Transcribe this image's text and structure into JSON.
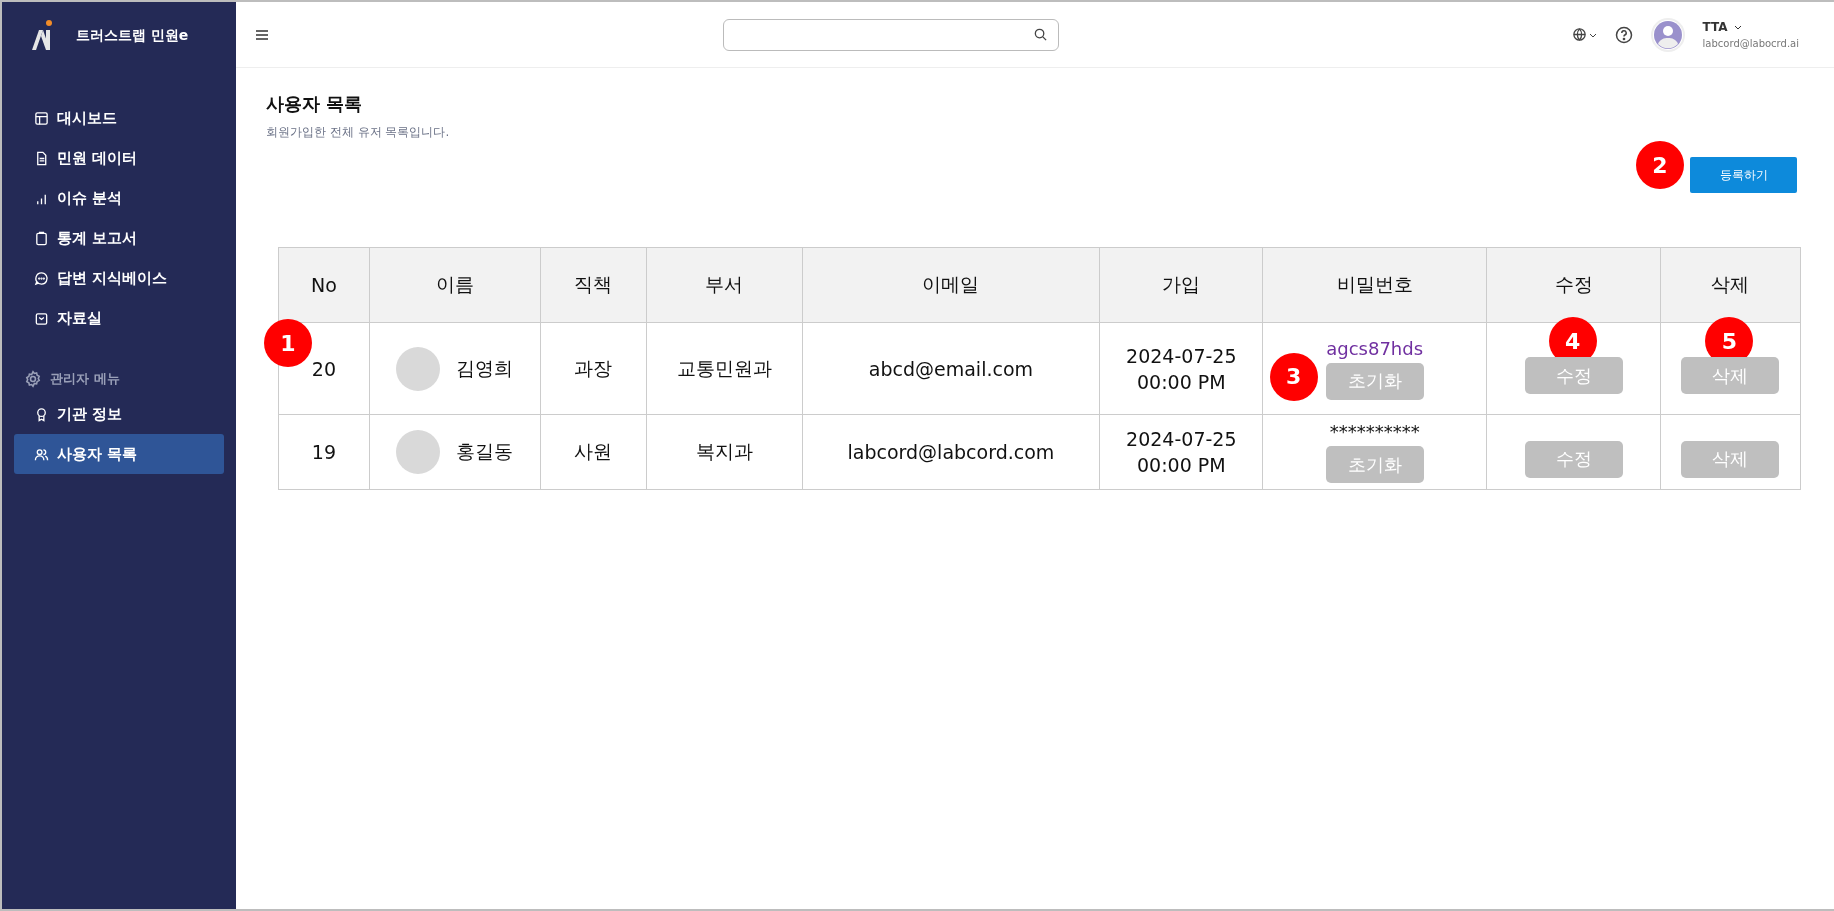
{
  "sidebar": {
    "brand": "트러스트랩 민원e",
    "items": [
      {
        "label": "대시보드",
        "selected": false
      },
      {
        "label": "민원 데이터",
        "selected": false
      },
      {
        "label": "이슈 분석",
        "selected": false
      },
      {
        "label": "통계 보고서",
        "selected": false
      },
      {
        "label": "답변 지식베이스",
        "selected": false
      },
      {
        "label": "자료실",
        "selected": false
      }
    ],
    "admin_section": {
      "label": "관리자 메뉴",
      "items": [
        {
          "label": "기관 정보",
          "selected": false
        },
        {
          "label": "사용자 목록",
          "selected": true
        }
      ]
    }
  },
  "header": {
    "user": {
      "name": "TTA",
      "email": "labcord@labocrd.ai"
    }
  },
  "page": {
    "title": "사용자 목록",
    "subtitle": "회원가입한 전체 유저 목록입니다.",
    "register_button": {
      "label": "등록하기",
      "badge": "2"
    }
  },
  "table": {
    "columns": [
      "No",
      "이름",
      "직책",
      "부서",
      "이메일",
      "가입",
      "비밀번호",
      "수정",
      "삭제"
    ],
    "rows": [
      {
        "no": "20",
        "no_badge": "1",
        "name": "김영희",
        "position": "과장",
        "department": "교통민원과",
        "email": "abcd@email.com",
        "joined": [
          "2024-07-25",
          "00:00 PM"
        ],
        "password": "agcs87hds",
        "revealed": true,
        "reset": {
          "label": "초기화",
          "badge": "3"
        },
        "edit": {
          "label": "수정",
          "badge": "4"
        },
        "delete": {
          "label": "삭제",
          "badge": "5"
        }
      },
      {
        "no": "19",
        "name": "홍길동",
        "position": "사원",
        "department": "복지과",
        "email": "labcord@labcord.com",
        "joined": [
          "2024-07-25",
          "00:00 PM"
        ],
        "password": "**********",
        "revealed": false,
        "reset": {
          "label": "초기화"
        },
        "edit": {
          "label": "수정"
        },
        "delete": {
          "label": "삭제"
        }
      }
    ]
  }
}
